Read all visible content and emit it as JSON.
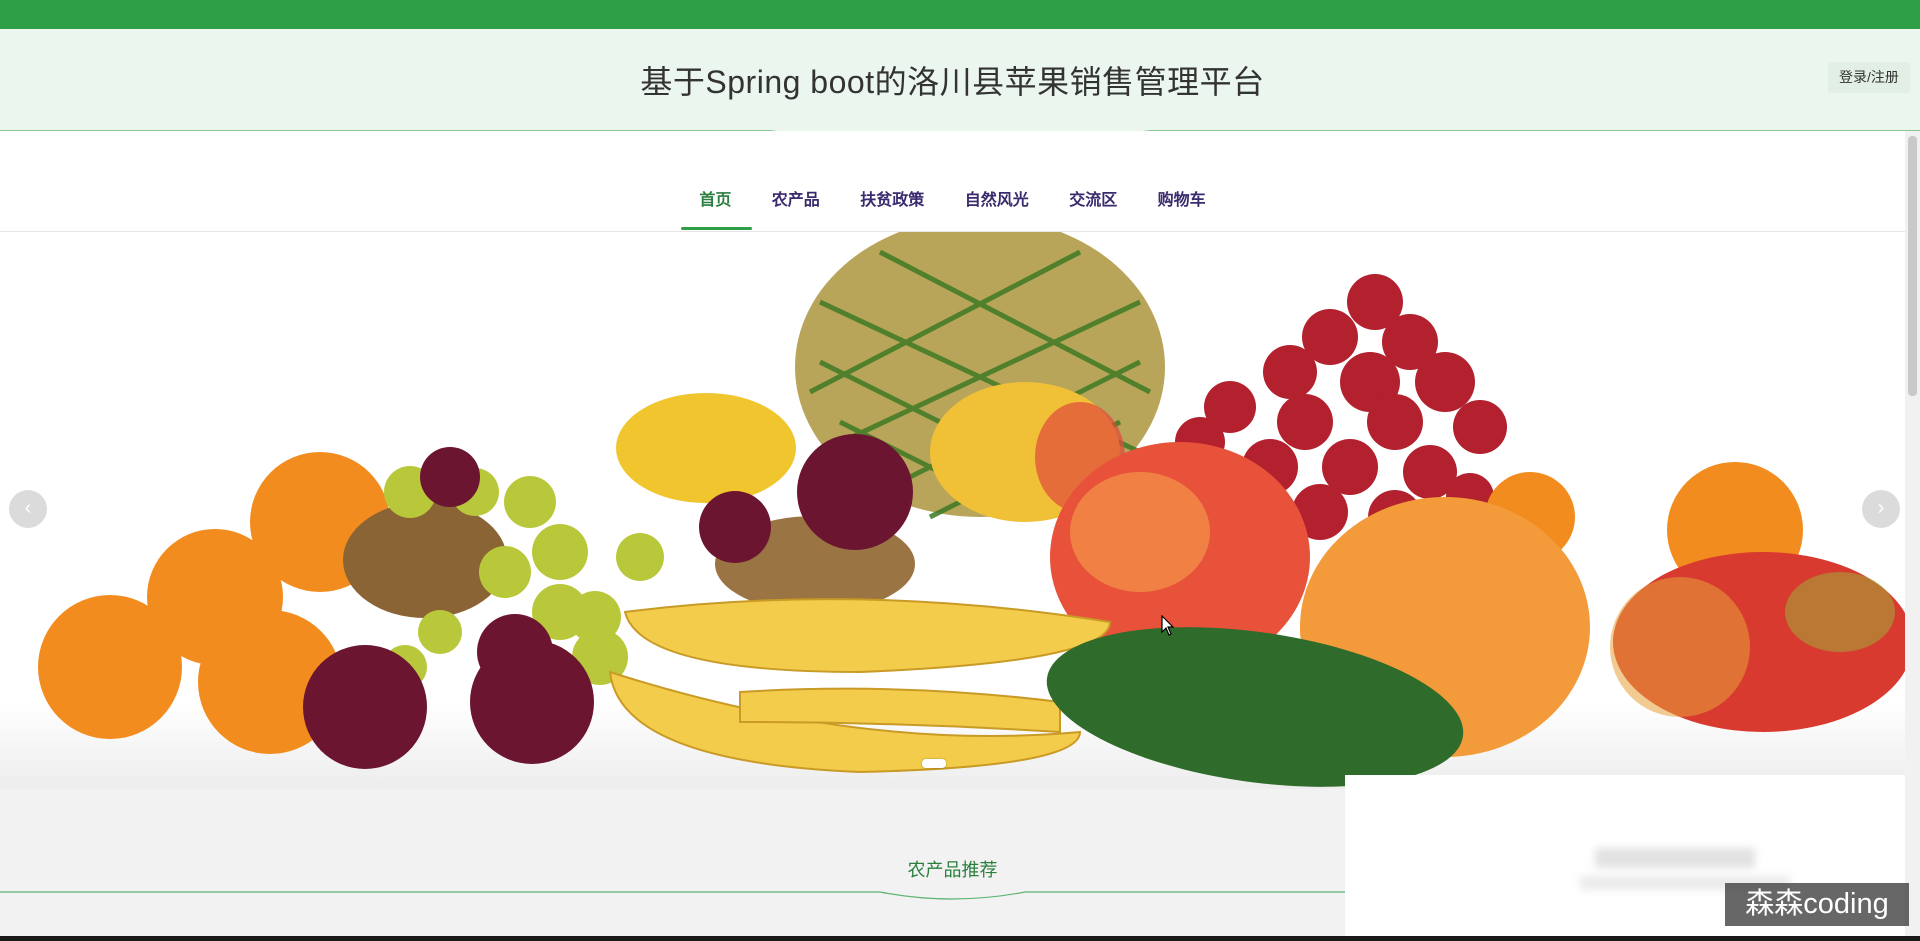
{
  "header": {
    "site_title": "基于Spring boot的洛川县苹果销售管理平台",
    "login_label": "登录/注册"
  },
  "nav": {
    "items": [
      {
        "label": "首页",
        "active": true
      },
      {
        "label": "农产品",
        "active": false
      },
      {
        "label": "扶贫政策",
        "active": false
      },
      {
        "label": "自然风光",
        "active": false
      },
      {
        "label": "交流区",
        "active": false
      },
      {
        "label": "购物车",
        "active": false
      }
    ]
  },
  "carousel": {
    "prev_icon": "‹",
    "next_icon": "›",
    "slide_count": 1,
    "active_slide": 1
  },
  "section": {
    "title": "农产品推荐"
  },
  "watermark": {
    "text": "森森coding"
  },
  "colors": {
    "brand_green": "#2e9e47",
    "header_bg": "#ebf6ee",
    "nav_text": "#3b2a6e"
  }
}
